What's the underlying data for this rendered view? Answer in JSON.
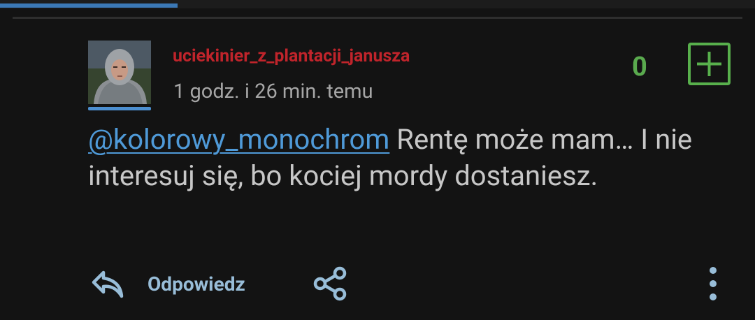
{
  "comment": {
    "username": "uciekinier_z_plantacji_janusza",
    "timestamp": "1 godz. i 26 min. temu",
    "mention": "@kolorowy_monochrom",
    "text": " Rentę może mam… I nie interesuj się, bo kociej mordy dostaniesz.",
    "score": "0"
  },
  "actions": {
    "reply_label": "Odpowiedz"
  },
  "colors": {
    "username": "#c0242b",
    "mention": "#4f9ad8",
    "score": "#5aaa4e",
    "accent": "#4c8fd0",
    "action_text": "#98bdd8"
  },
  "icons": [
    "plus-square-icon",
    "reply-arrow-icon",
    "share-icon",
    "more-vertical-icon"
  ]
}
